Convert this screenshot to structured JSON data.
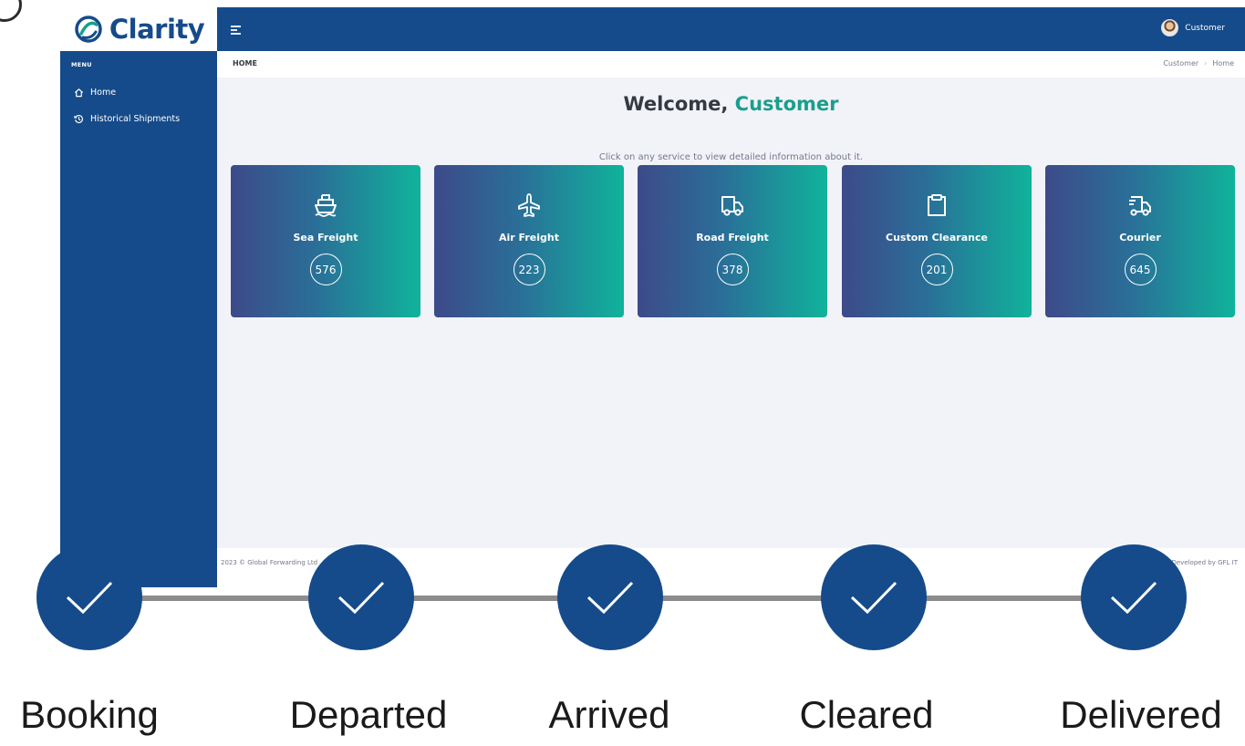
{
  "app": {
    "name": "Clarity"
  },
  "user": {
    "name": "Customer"
  },
  "sidebar": {
    "menu_title": "MENU",
    "items": [
      {
        "label": "Home",
        "icon": "home-icon"
      },
      {
        "label": "Historical Shipments",
        "icon": "history-icon"
      }
    ]
  },
  "breadcrumb": {
    "page": "HOME",
    "trail": [
      "Customer",
      "Home"
    ],
    "separator": "›"
  },
  "welcome": {
    "greeting": "Welcome,",
    "name": "Customer",
    "subtitle": "Click on any service to view detailed information about it."
  },
  "services": [
    {
      "label": "Sea Freight",
      "count": "576",
      "icon": "ship-icon"
    },
    {
      "label": "Air Freight",
      "count": "223",
      "icon": "plane-icon"
    },
    {
      "label": "Road Freight",
      "count": "378",
      "icon": "truck-icon"
    },
    {
      "label": "Custom Clearance",
      "count": "201",
      "icon": "clipboard-icon"
    },
    {
      "label": "Courier",
      "count": "645",
      "icon": "fast-truck-icon"
    }
  ],
  "footer": {
    "left": "2023 © Global Forwarding Ltd",
    "right": "Developed by GFL IT"
  },
  "tracker": {
    "steps": [
      "Booking",
      "Departed",
      "Arrived",
      "Cleared",
      "Delivered"
    ],
    "completed": [
      true,
      true,
      true,
      true,
      true
    ]
  },
  "colors": {
    "brand": "#154b8a",
    "accent": "#1a9e8d",
    "track": "#8c8c8c"
  }
}
